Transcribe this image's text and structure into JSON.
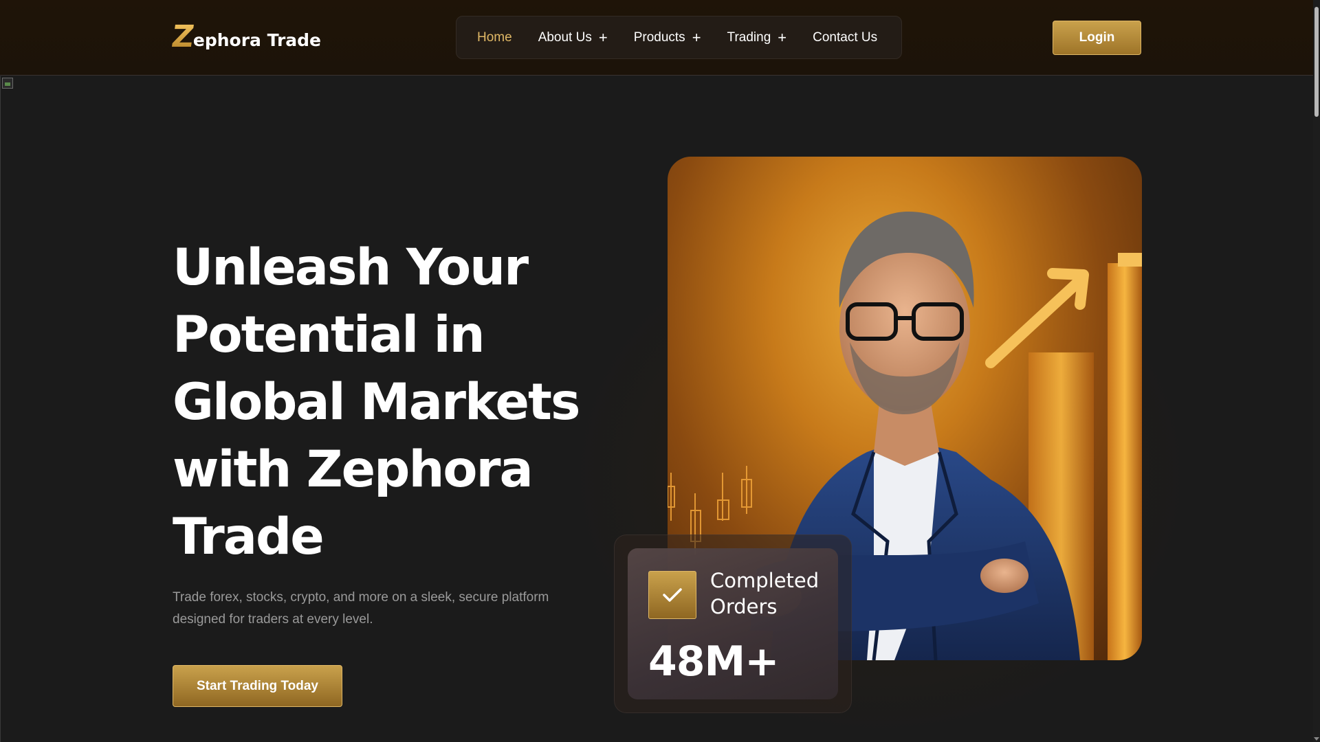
{
  "header": {
    "logo_mark": "Z",
    "logo_text": "ephora Trade",
    "nav": [
      {
        "label": "Home",
        "active": true,
        "has_submenu": false
      },
      {
        "label": "About Us",
        "active": false,
        "has_submenu": true
      },
      {
        "label": "Products",
        "active": false,
        "has_submenu": true
      },
      {
        "label": "Trading",
        "active": false,
        "has_submenu": true
      },
      {
        "label": "Contact Us",
        "active": false,
        "has_submenu": false
      }
    ],
    "submenu_glyph": "+",
    "login_label": "Login"
  },
  "hero": {
    "headline": "Unleash Your Potential in Global Markets with Zephora Trade",
    "subtext": "Trade forex, stocks, crypto, and more on a sleek, secure platform designed for traders at every level.",
    "cta_label": "Start Trading Today",
    "stat": {
      "label": "Completed Orders",
      "value": "48M+",
      "icon": "check-icon"
    }
  },
  "colors": {
    "accent_gold": "#c9a14c",
    "nav_active": "#e0b866",
    "background": "#1b1b1b",
    "subtext": "#9a9a9a"
  }
}
